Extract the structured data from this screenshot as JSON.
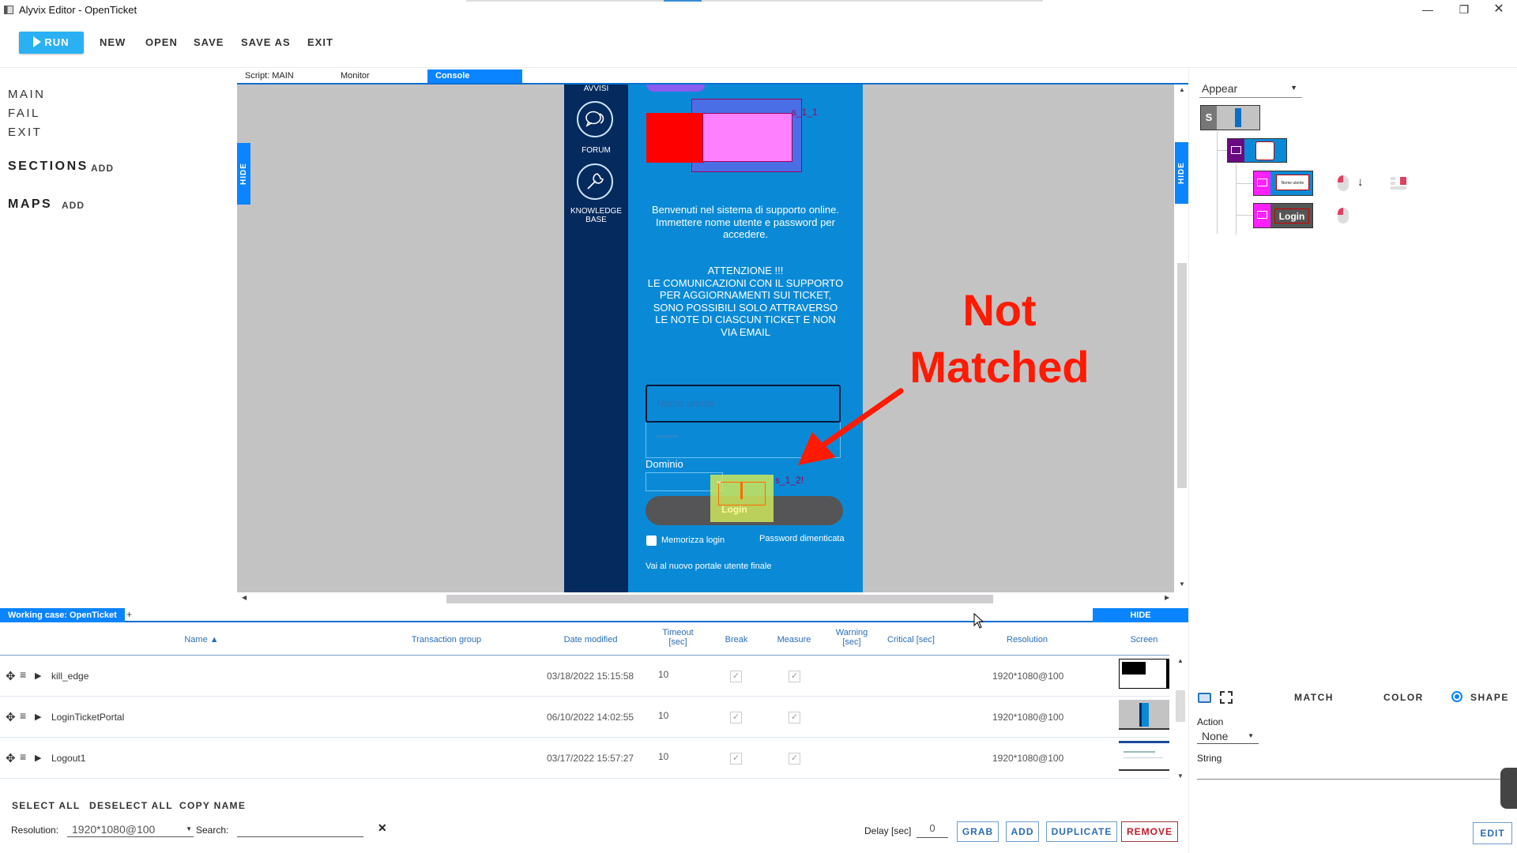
{
  "window": {
    "title": "Alyvix Editor - OpenTicket",
    "controls": [
      "minimize",
      "restore",
      "close"
    ]
  },
  "toolbar": {
    "run_label": "RUN",
    "new_label": "NEW",
    "open_label": "OPEN",
    "save_label": "SAVE",
    "save_as_label": "SAVE AS",
    "exit_label": "EXIT"
  },
  "left_panel": {
    "scripts": [
      "MAIN",
      "FAIL",
      "EXIT"
    ],
    "sections_label": "SECTIONS",
    "sections_add": "ADD",
    "maps_label": "MAPS",
    "maps_add": "ADD"
  },
  "tabs": [
    {
      "label": "Script: MAIN",
      "active": false
    },
    {
      "label": "Monitor",
      "active": false
    },
    {
      "label": "Console",
      "active": true
    }
  ],
  "canvas": {
    "hide_left": "HIDE",
    "hide_right": "HIDE",
    "portal": {
      "nav": [
        {
          "label": "AVVISI",
          "icon": "alert-icon"
        },
        {
          "label": "FORUM",
          "icon": "chat-bubbles-icon"
        },
        {
          "label": "KNOWLEDGE BASE",
          "icon": "wrench-icon"
        }
      ],
      "welcome_lines": [
        "Benvenuti nel sistema di supporto online.",
        "Immettere nome utente e password per",
        "accedere."
      ],
      "warning_lines": [
        "ATTENZIONE !!!",
        "LE COMUNICAZIONI CON IL SUPPORTO",
        "PER AGGIORNAMENTI SUI TICKET,",
        "SONO POSSIBILI SOLO ATTRAVERSO",
        "LE NOTE DI CIASCUN TICKET E NON",
        "VIA EMAIL"
      ],
      "username_placeholder": "Nome utente",
      "password_placeholder": "••••••••",
      "domain_label": "Dominio",
      "login_label": "Login",
      "remember_label": "Memorizza login",
      "forgot_label": "Password dimenticata",
      "new_portal_label": "Vai al nuovo portale utente finale"
    },
    "overlays": {
      "s1_label": "s_1_1",
      "s2_label": "s_1_2!",
      "annotation": [
        "Not",
        "Matched"
      ],
      "colors": {
        "annotation": "#ff1a00",
        "match_box": "#ff80ff",
        "match_outline": "#a0005a",
        "fail_box": "#c8e06a"
      }
    }
  },
  "bottom": {
    "working_case_tab": "Working case: OpenTicket",
    "add_tab": "+",
    "hide_label": "HIDE",
    "columns": [
      "Name ▲",
      "Transaction group",
      "Date modified",
      "Timeout [sec]",
      "Break",
      "Measure",
      "Warning [sec]",
      "Critical [sec]",
      "Resolution",
      "Screen"
    ],
    "rows": [
      {
        "name": "kill_edge",
        "transaction_group": "",
        "date_modified": "03/18/2022 15:15:58",
        "timeout": "10",
        "break": true,
        "measure": true,
        "warning": "",
        "critical": "",
        "resolution": "1920*1080@100"
      },
      {
        "name": "LoginTicketPortal",
        "transaction_group": "",
        "date_modified": "06/10/2022 14:02:55",
        "timeout": "10",
        "break": true,
        "measure": true,
        "warning": "",
        "critical": "",
        "resolution": "1920*1080@100"
      },
      {
        "name": "Logout1",
        "transaction_group": "",
        "date_modified": "03/17/2022 15:57:27",
        "timeout": "10",
        "break": true,
        "measure": true,
        "warning": "",
        "critical": "",
        "resolution": "1920*1080@100"
      }
    ],
    "select_all": "SELECT ALL",
    "deselect_all": "DESELECT ALL",
    "copy_name": "COPY NAME",
    "resolution_label": "Resolution:",
    "resolution_value": "1920*1080@100",
    "search_label": "Search:",
    "search_value": "",
    "clear_icon": "✕",
    "delay_label": "Delay [sec]",
    "delay_value": "0",
    "grab": "GRAB",
    "add": "ADD",
    "duplicate": "DUPLICATE",
    "remove": "REMOVE"
  },
  "right_panel": {
    "mode_select": "Appear",
    "tree": [
      {
        "type": "S",
        "label": "S"
      },
      {
        "type": "image",
        "label": ""
      },
      {
        "type": "image",
        "label": "Nome utente"
      },
      {
        "type": "image",
        "label": "Login"
      }
    ],
    "radio": {
      "match": "MATCH",
      "color": "COLOR",
      "shape": "SHAPE",
      "selected": "SHAPE"
    },
    "action_label": "Action",
    "action_value": "None",
    "string_label": "String",
    "string_value": "",
    "edit": "EDIT"
  }
}
